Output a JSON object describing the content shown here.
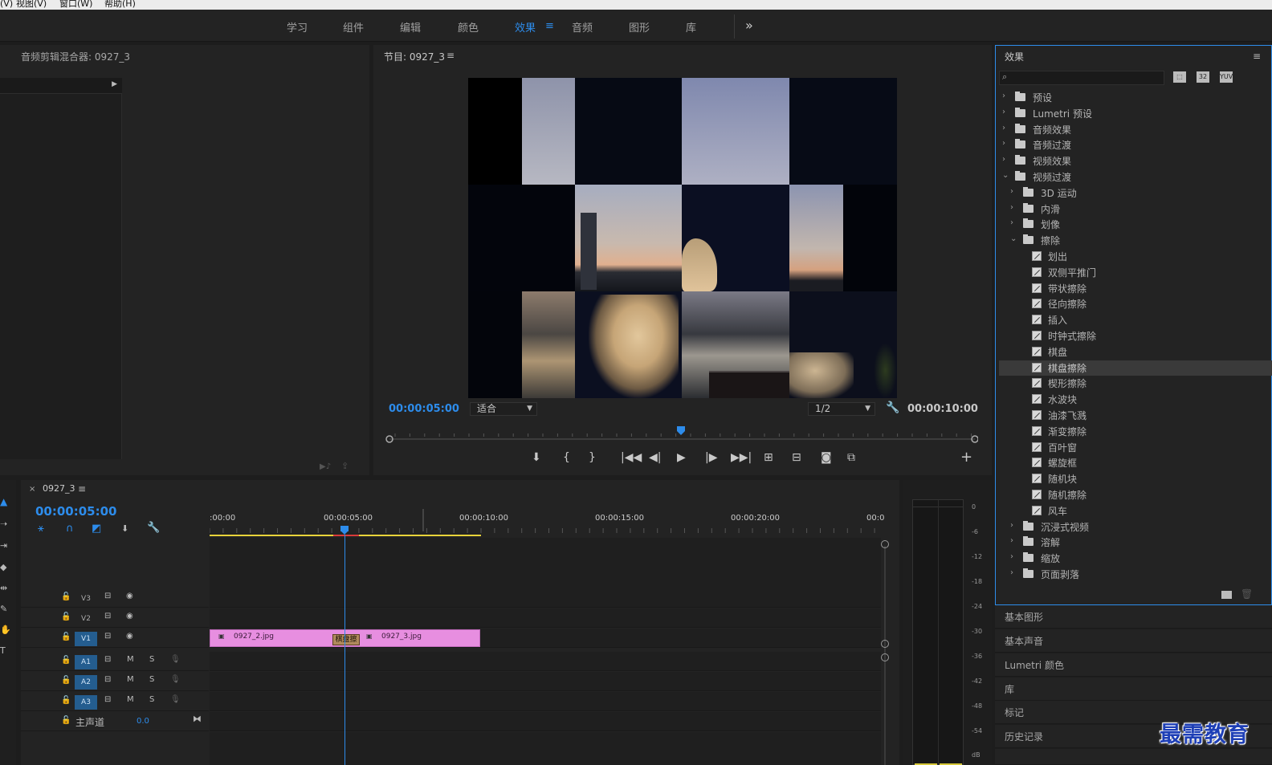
{
  "menubar": {
    "items": [
      "(V)",
      "视图(V)",
      "窗口(W)",
      "帮助(H)"
    ]
  },
  "workspace": {
    "tabs": [
      "学习",
      "组件",
      "编辑",
      "颜色",
      "效果",
      "音频",
      "图形",
      "库"
    ],
    "active": "效果",
    "menu_icon": "hamburger-icon",
    "more_icon": "double-chevron-right-icon"
  },
  "mixer": {
    "title": "音频剪辑混合器: 0927_3"
  },
  "program": {
    "title": "节目: 0927_3",
    "timecode_current": "00:00:05:00",
    "timecode_duration": "00:00:10:00",
    "fit_label": "适合",
    "resolution_label": "1/2"
  },
  "timeline": {
    "sequence_name": "0927_3",
    "timecode": "00:00:05:00",
    "ruler": [
      ":00:00",
      "00:00:05:00",
      "00:00:10:00",
      "00:00:15:00",
      "00:00:20:00",
      "00:0"
    ],
    "video_tracks": [
      "V3",
      "V2",
      "V1"
    ],
    "audio_tracks": [
      "A1",
      "A2",
      "A3"
    ],
    "master_label": "主声道",
    "master_value": "0.0",
    "clips": [
      {
        "name": "0927_2.jpg"
      },
      {
        "name": "0927_3.jpg"
      }
    ],
    "transition_label": "棋盘擦"
  },
  "meter": {
    "scale": [
      "0",
      "-6",
      "-12",
      "-18",
      "-24",
      "-30",
      "-36",
      "-42",
      "-48",
      "-54",
      "dB"
    ]
  },
  "effects": {
    "title": "效果",
    "tree": [
      {
        "label": "预设",
        "level": 0,
        "type": "folder",
        "expanded": false
      },
      {
        "label": "Lumetri 预设",
        "level": 0,
        "type": "folder",
        "expanded": false
      },
      {
        "label": "音频效果",
        "level": 0,
        "type": "folder",
        "expanded": false
      },
      {
        "label": "音频过渡",
        "level": 0,
        "type": "folder",
        "expanded": false
      },
      {
        "label": "视频效果",
        "level": 0,
        "type": "folder",
        "expanded": false
      },
      {
        "label": "视频过渡",
        "level": 0,
        "type": "folder",
        "expanded": true
      },
      {
        "label": "3D 运动",
        "level": 1,
        "type": "folder",
        "expanded": false
      },
      {
        "label": "内滑",
        "level": 1,
        "type": "folder",
        "expanded": false
      },
      {
        "label": "划像",
        "level": 1,
        "type": "folder",
        "expanded": false
      },
      {
        "label": "擦除",
        "level": 1,
        "type": "folder",
        "expanded": true
      },
      {
        "label": "划出",
        "level": 2,
        "type": "effect"
      },
      {
        "label": "双侧平推门",
        "level": 2,
        "type": "effect"
      },
      {
        "label": "带状擦除",
        "level": 2,
        "type": "effect"
      },
      {
        "label": "径向擦除",
        "level": 2,
        "type": "effect"
      },
      {
        "label": "插入",
        "level": 2,
        "type": "effect"
      },
      {
        "label": "时钟式擦除",
        "level": 2,
        "type": "effect"
      },
      {
        "label": "棋盘",
        "level": 2,
        "type": "effect"
      },
      {
        "label": "棋盘擦除",
        "level": 2,
        "type": "effect",
        "selected": true
      },
      {
        "label": "楔形擦除",
        "level": 2,
        "type": "effect"
      },
      {
        "label": "水波块",
        "level": 2,
        "type": "effect"
      },
      {
        "label": "油漆飞溅",
        "level": 2,
        "type": "effect"
      },
      {
        "label": "渐变擦除",
        "level": 2,
        "type": "effect"
      },
      {
        "label": "百叶窗",
        "level": 2,
        "type": "effect"
      },
      {
        "label": "螺旋框",
        "level": 2,
        "type": "effect"
      },
      {
        "label": "随机块",
        "level": 2,
        "type": "effect"
      },
      {
        "label": "随机擦除",
        "level": 2,
        "type": "effect"
      },
      {
        "label": "风车",
        "level": 2,
        "type": "effect"
      },
      {
        "label": "沉浸式视频",
        "level": 1,
        "type": "folder",
        "expanded": false
      },
      {
        "label": "溶解",
        "level": 1,
        "type": "folder",
        "expanded": false
      },
      {
        "label": "缩放",
        "level": 1,
        "type": "folder",
        "expanded": false
      },
      {
        "label": "页面剥落",
        "level": 1,
        "type": "folder",
        "expanded": false
      }
    ]
  },
  "right_panels": [
    "基本图形",
    "基本声音",
    "Lumetri 颜色",
    "库",
    "标记",
    "历史记录"
  ],
  "watermark": "最需教育",
  "colors": {
    "accent": "#2d8ceb",
    "clip": "#e78ee0",
    "playhead": "#2d8ceb"
  }
}
